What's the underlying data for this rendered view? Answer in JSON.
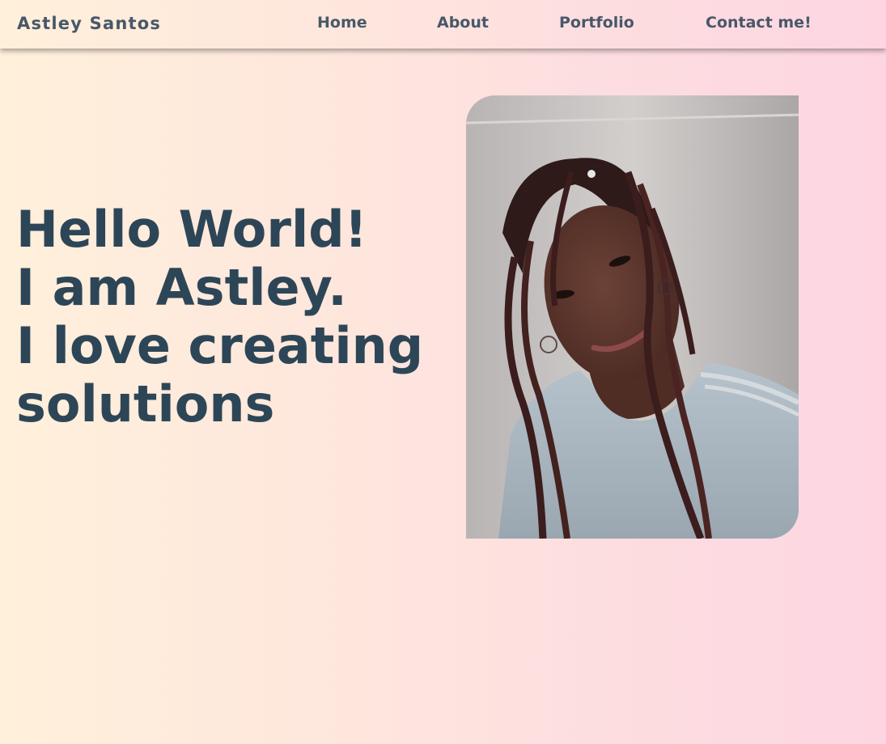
{
  "navbar": {
    "brand": "Astley Santos",
    "links": [
      {
        "label": "Home"
      },
      {
        "label": "About"
      },
      {
        "label": "Portfolio"
      },
      {
        "label": "Contact me!"
      }
    ]
  },
  "hero": {
    "lines": [
      "Hello World!",
      "I am Astley.",
      "I love creating",
      "solutions"
    ]
  },
  "photo": {
    "icon": "portrait-photo"
  },
  "colors": {
    "heading": "#2d4657",
    "nav_text": "#485868",
    "gradient_start": "#fff0db",
    "gradient_end": "#fdd6e2"
  }
}
